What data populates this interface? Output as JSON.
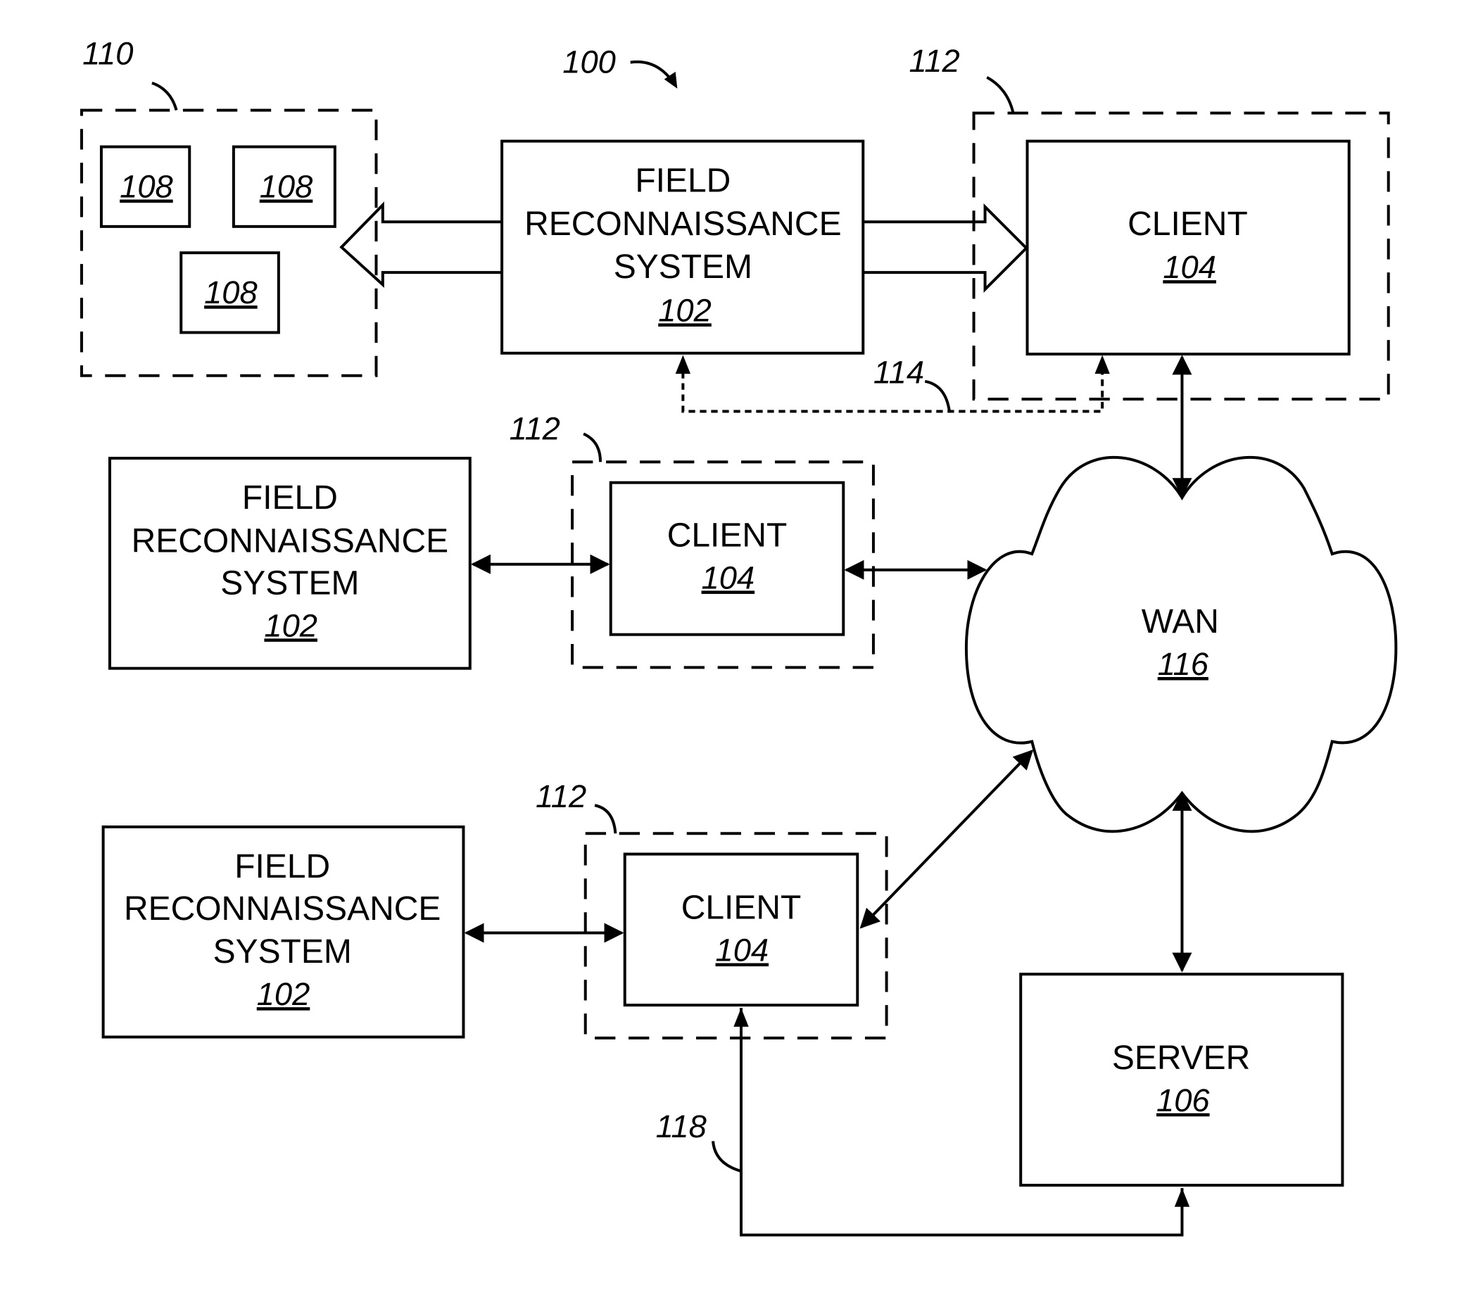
{
  "figure": {
    "ref": "100",
    "refs": {
      "device_group": "110",
      "client_enclosure": "112",
      "local_link": "114",
      "server_link": "118"
    },
    "devices": [
      {
        "num": "108"
      },
      {
        "num": "108"
      },
      {
        "num": "108"
      }
    ],
    "field_systems": [
      {
        "lines": [
          "FIELD",
          "RECONNAISSANCE",
          "SYSTEM"
        ],
        "num": "102"
      },
      {
        "lines": [
          "FIELD",
          "RECONNAISSANCE",
          "SYSTEM"
        ],
        "num": "102"
      },
      {
        "lines": [
          "FIELD",
          "RECONNAISSANCE",
          "SYSTEM"
        ],
        "num": "102"
      }
    ],
    "clients": [
      {
        "label": "CLIENT",
        "num": "104"
      },
      {
        "label": "CLIENT",
        "num": "104"
      },
      {
        "label": "CLIENT",
        "num": "104"
      }
    ],
    "wan": {
      "label": "WAN",
      "num": "116"
    },
    "server": {
      "label": "SERVER",
      "num": "106"
    }
  }
}
